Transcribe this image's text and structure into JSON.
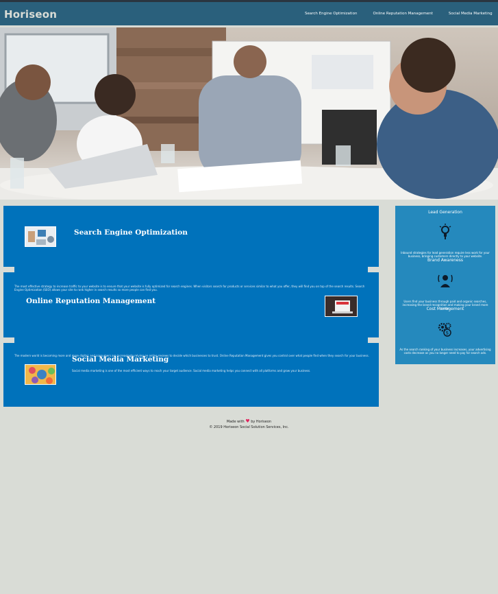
{
  "header": {
    "logo": "Horiseon",
    "nav": [
      "Search Engine Optimization",
      "Online Reputation Management",
      "Social Media Marketing"
    ]
  },
  "hero": {
    "image": "team-meeting-photo"
  },
  "sections": [
    {
      "title": "Search Engine Optimization",
      "icon": "seo-thumbnail",
      "text": "The most effective strategy to increase traffic to your website is to ensure that your website is fully optimized for search engines. When visitors search for products or services similar to what you offer, they will find you on top of the search results. Search Engine Optimization (SEO) allows your site to rank higher in search results so more people can find you."
    },
    {
      "title": "Online Reputation Management",
      "icon": "reputation-thumbnail",
      "text": "The modern world is becoming more and more digital, and consumers are increasingly relying on online reviews to decide which businesses to trust. Online Reputation Management gives you control over what people find when they search for your business."
    },
    {
      "title": "Social Media Marketing",
      "icon": "social-thumbnail",
      "text": "Social media marketing is one of the most efficient ways to reach your target audience. Social media marketing helps you connect with all platforms and grow your business."
    }
  ],
  "benefits": {
    "title": "Lead Generation",
    "items": [
      {
        "icon": "lightbulb-icon",
        "text": "Inbound strategies for lead generation require less work for your business, bringing customers directly to your website.",
        "heading": "Brand Awareness"
      },
      {
        "icon": "megaphone-person-icon",
        "text": "Users find your business through paid and organic searches, increasing the brand recognition and making your brand more visible.",
        "heading": "Cost Management"
      },
      {
        "icon": "gears-money-icon",
        "text": "As the search ranking of your business increases, your advertising costs decrease as you no longer need to pay for search ads.",
        "heading": ""
      }
    ]
  },
  "footer": {
    "made_with": "Made with",
    "by": "by Horiseon",
    "copyright": "© 2019 Horiseon Social Solution Services, Inc."
  },
  "colors": {
    "header": "#2a607c",
    "content": "#0072bb",
    "sidebar": "#2589bd",
    "page": "#d9dcd6"
  }
}
